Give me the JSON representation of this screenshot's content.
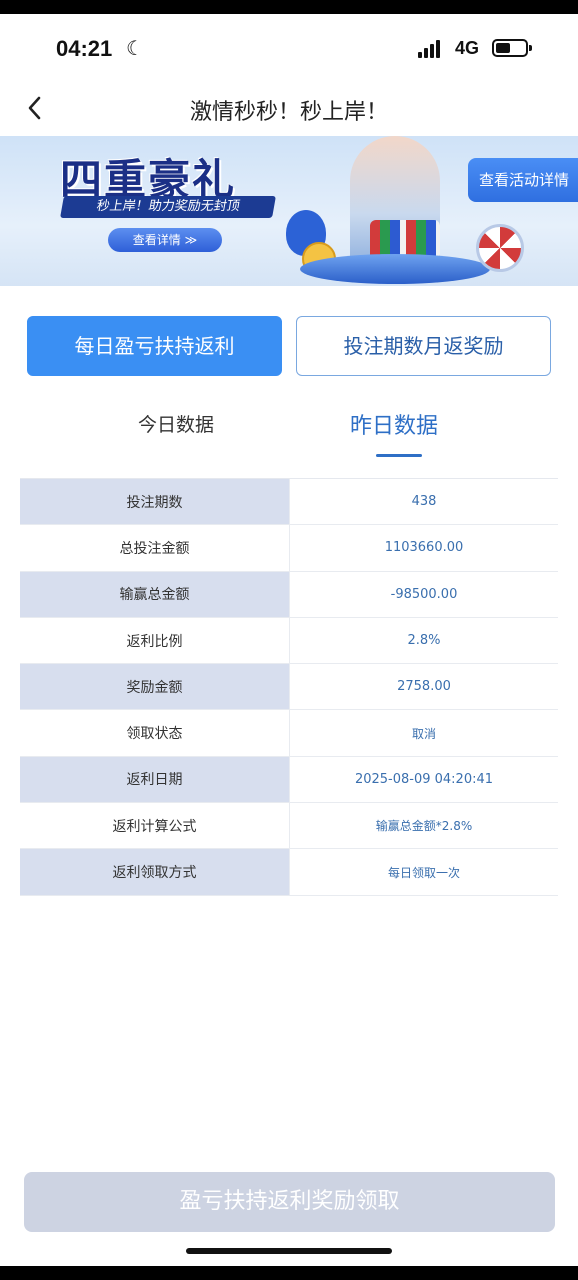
{
  "status_bar": {
    "time": "04:21",
    "network": "4G"
  },
  "nav": {
    "title": "激情秒秒！秒上岸！"
  },
  "banner": {
    "headline": "四重豪礼",
    "subline": "秒上岸！助力奖励无封顶",
    "detail_pill": "查看详情 ≫",
    "view_details": "查看活动详情"
  },
  "tabs": {
    "daily": "每日盈亏扶持返利",
    "monthly": "投注期数月返奖励"
  },
  "date_tabs": {
    "today": "今日数据",
    "yesterday": "昨日数据"
  },
  "table": {
    "rows": [
      {
        "key": "投注期数",
        "value": "438"
      },
      {
        "key": "总投注金额",
        "value": "1103660.00"
      },
      {
        "key": "输赢总金额",
        "value": "-98500.00"
      },
      {
        "key": "返利比例",
        "value": "2.8%"
      },
      {
        "key": "奖励金额",
        "value": "2758.00"
      },
      {
        "key": "领取状态",
        "value": "取消"
      },
      {
        "key": "返利日期",
        "value": "2025-08-09 04:20:41"
      },
      {
        "key": "返利计算公式",
        "value": "输赢总金额*2.8%"
      },
      {
        "key": "返利领取方式",
        "value": "每日领取一次"
      }
    ]
  },
  "footer": {
    "claim_label": "盈亏扶持返利奖励领取"
  },
  "colors": {
    "primary": "#3a8ff3",
    "link": "#2e6fc6",
    "row_alt": "#d7deee",
    "disabled": "#cdd3e2"
  }
}
